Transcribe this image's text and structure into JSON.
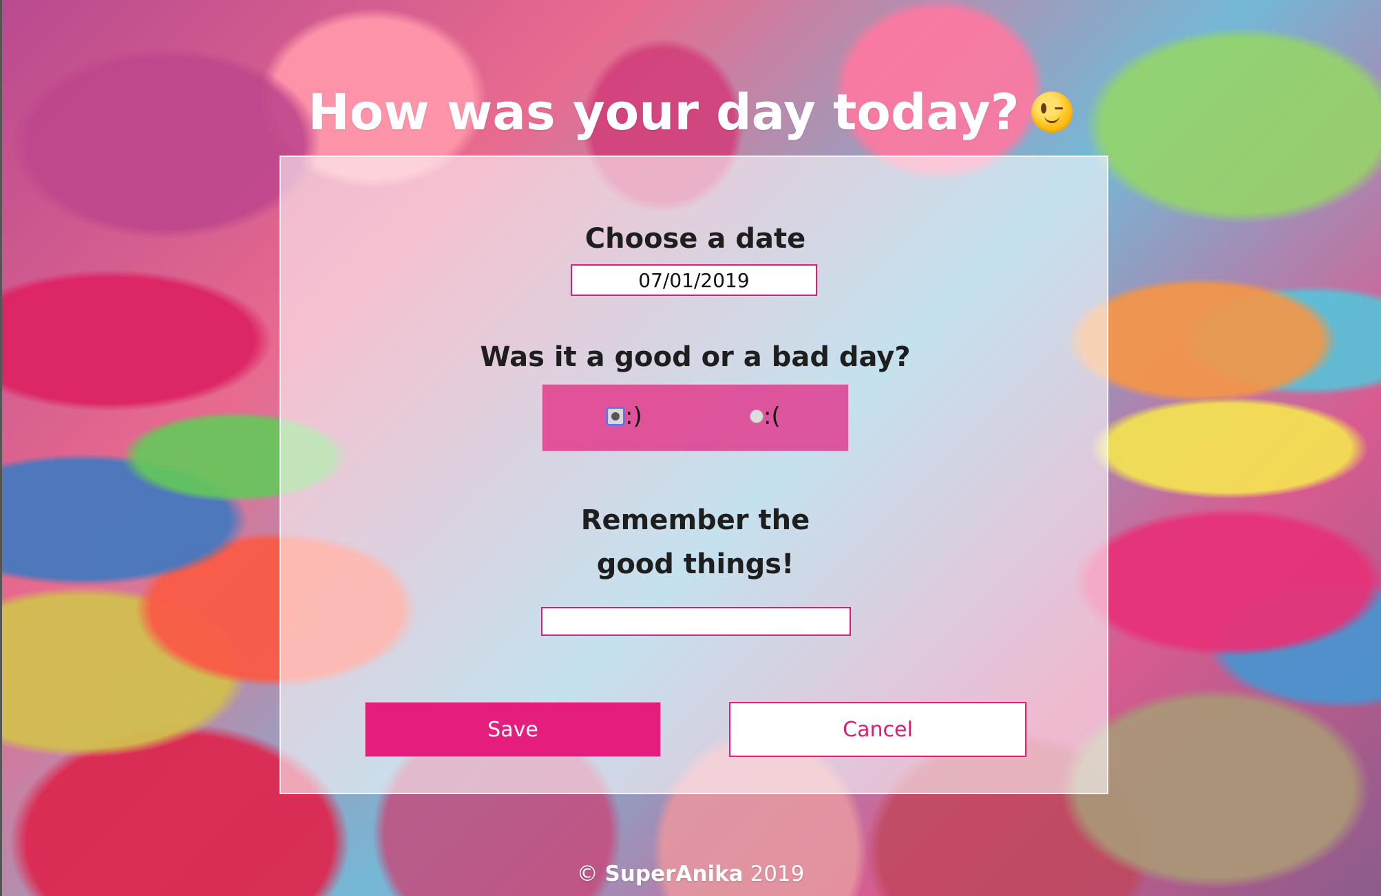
{
  "page": {
    "heading": "How was your day today?",
    "heading_icon": "winking-face-icon"
  },
  "form": {
    "date_label": "Choose a date",
    "date_value": "07/01/2019",
    "mood_label": "Was it a good or a bad day?",
    "mood_options": [
      {
        "label": ":)",
        "selected": true
      },
      {
        "label": ":(",
        "selected": false
      }
    ],
    "good_things_label": "Remember the good things!",
    "good_things_value": "",
    "save_label": "Save",
    "cancel_label": "Cancel"
  },
  "footer": {
    "copyright_symbol": "©",
    "author": "SuperAnika",
    "year": "2019"
  },
  "colors": {
    "accent": "#e51e7d",
    "panel": "rgba(255,255,255,0.58)",
    "text": "#1e1e1e"
  }
}
